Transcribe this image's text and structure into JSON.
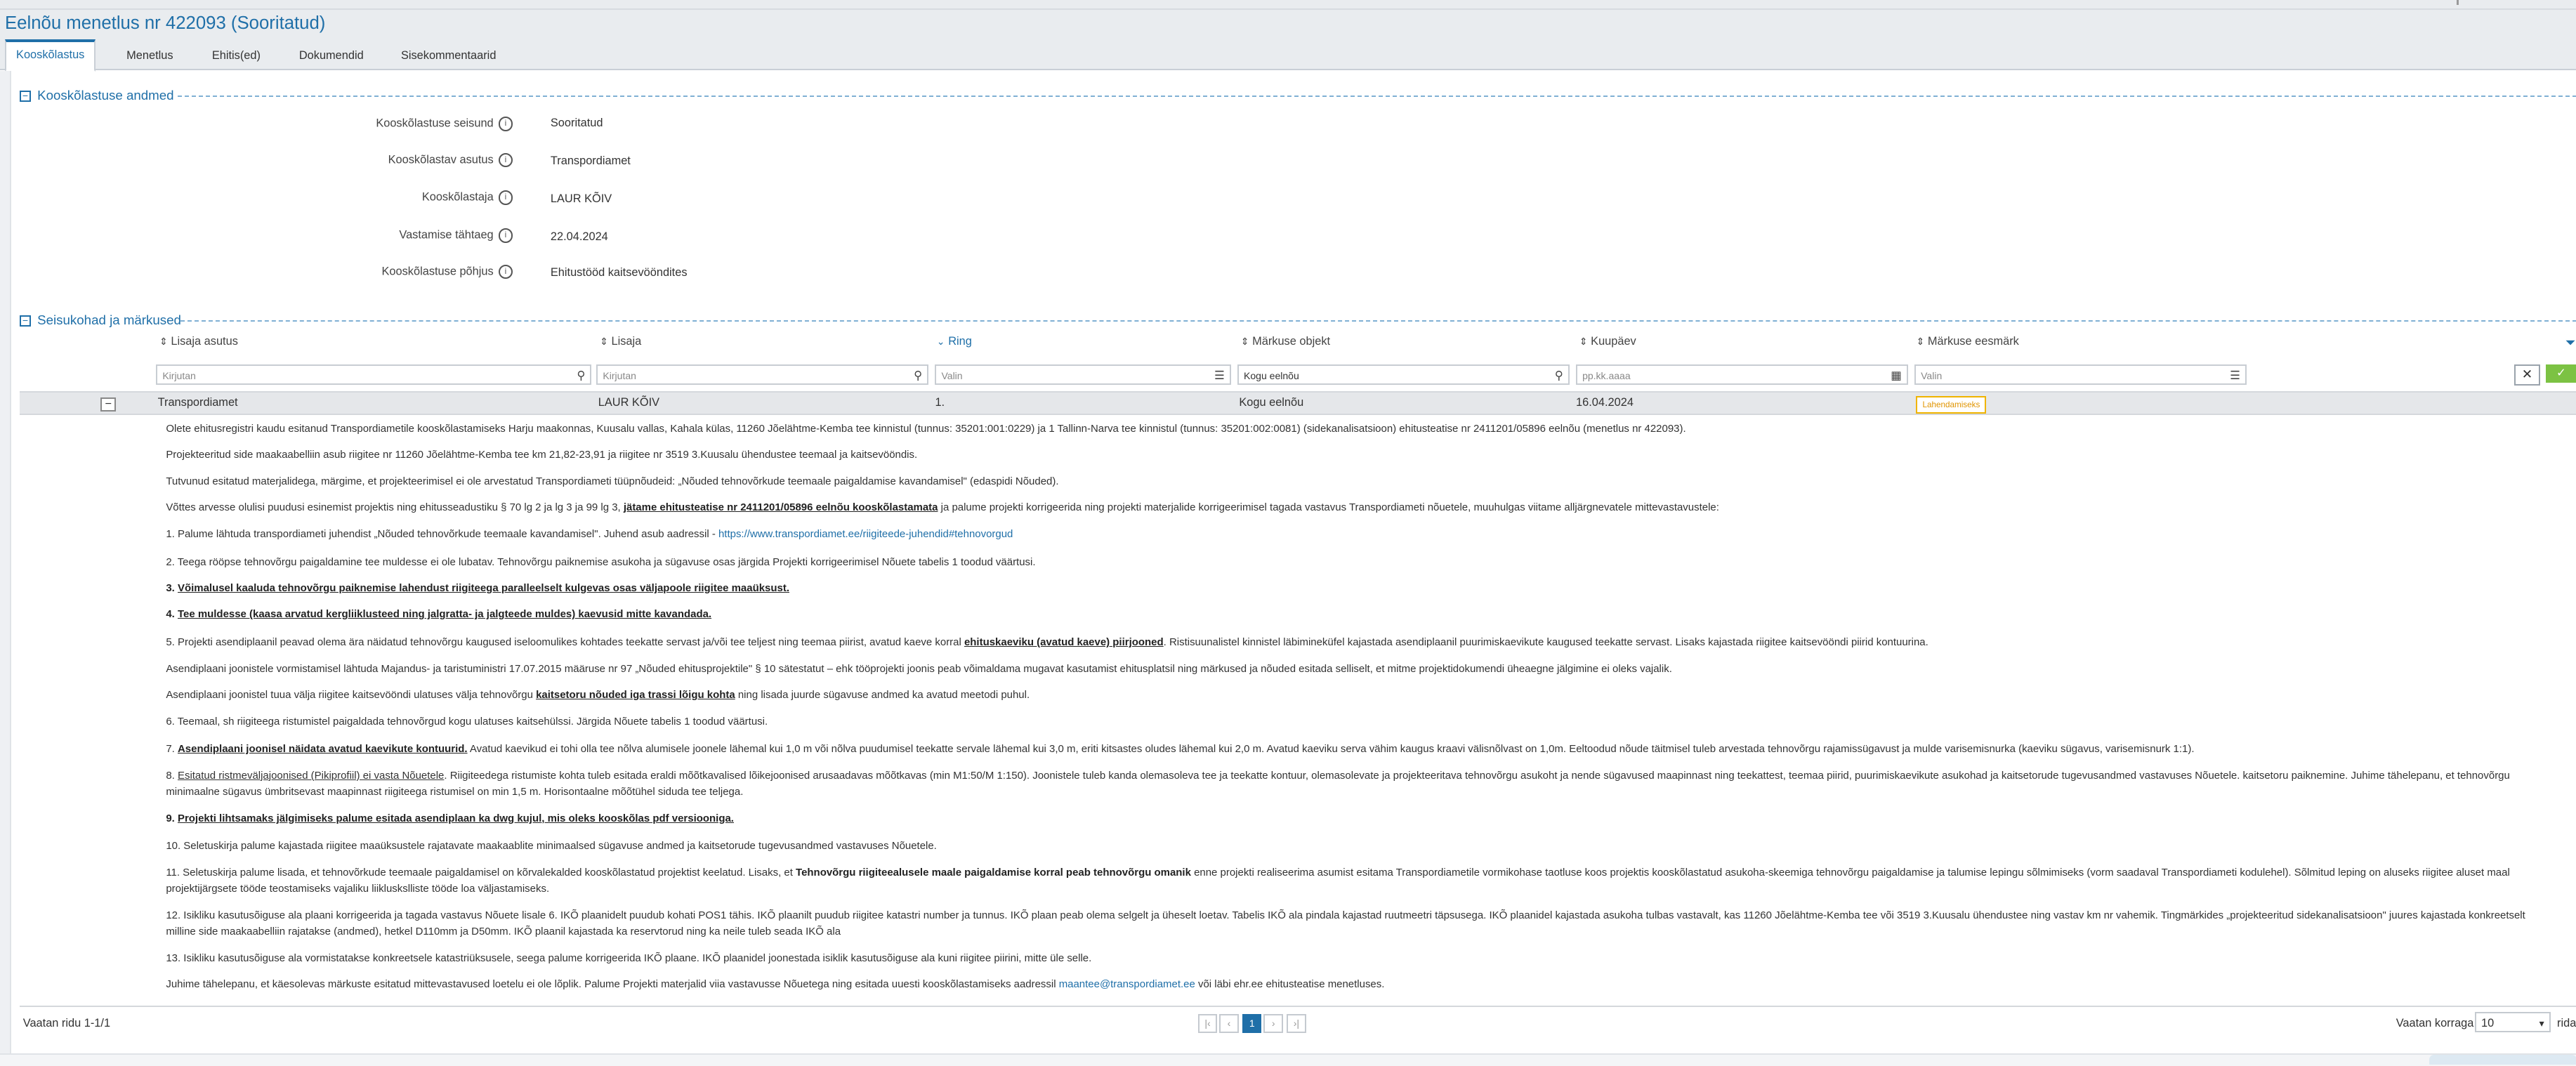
{
  "page": {
    "title": "Eelnõu menetlus nr 422093 (Sooritatud)"
  },
  "tabs": [
    {
      "label": "Kooskõlastus",
      "active": true
    },
    {
      "label": "Menetlus"
    },
    {
      "label": "Ehitis(ed)"
    },
    {
      "label": "Dokumendid"
    },
    {
      "label": "Sisekommentaarid"
    }
  ],
  "section1": {
    "title": "Kooskõlastuse andmed",
    "toggle": "−",
    "fields": [
      {
        "label": "Kooskõlastuse seisund",
        "value": "Sooritatud"
      },
      {
        "label": "Kooskõlastav asutus",
        "value": "Transpordiamet"
      },
      {
        "label": "Kooskõlastaja",
        "value": "LAUR KÕIV"
      },
      {
        "label": "Vastamise tähtaeg",
        "value": "22.04.2024"
      },
      {
        "label": "Kooskõlastuse põhjus",
        "value": "Ehitustööd kaitsevööndites"
      }
    ]
  },
  "section2": {
    "title": "Seisukohad ja märkused",
    "toggle": "−",
    "columns": [
      {
        "label": "Lisaja asutus",
        "sort": "⇕"
      },
      {
        "label": "Lisaja",
        "sort": "⇕"
      },
      {
        "label": "Ring",
        "sort": "⌄"
      },
      {
        "label": "Märkuse objekt",
        "sort": "⇕"
      },
      {
        "label": "Kuupäev",
        "sort": "⇕"
      },
      {
        "label": "Märkuse eesmärk",
        "sort": "⇕"
      }
    ],
    "filters": [
      {
        "placeholder": "Kirjutan",
        "icon": "⚲"
      },
      {
        "placeholder": "Kirjutan",
        "icon": "⚲"
      },
      {
        "placeholder": "Valin",
        "icon": "☰"
      },
      {
        "placeholder": "Kogu eelnõu",
        "icon": "⚲"
      },
      {
        "placeholder": "pp.kk.aaaa",
        "icon": "▦"
      },
      {
        "placeholder": "Valin",
        "icon": "☰"
      }
    ],
    "clear_label": "✕",
    "apply_label": "✓",
    "row": {
      "collapse": "−",
      "asutus": "Transpordiamet",
      "lisaja": "LAUR KÕIV",
      "ring": "1.",
      "objekt": "Kogu eelnõu",
      "kuupaev": "16.04.2024",
      "eesmark": "Lahendamiseks"
    },
    "detail": {
      "p1": "Olete ehitusregistri kaudu esitanud Transpordiametile kooskõlastamiseks Harju maakonnas, Kuusalu vallas, Kahala külas, 11260 Jõelähtme-Kemba tee kinnistul (tunnus: 35201:001:0229) ja 1 Tallinn-Narva tee kinnistul (tunnus: 35201:002:0081) (sidekanalisatsioon) ehitusteatise nr 2411201/05896 eelnõu (menetlus nr 422093).",
      "p2": "Projekteeritud side maakaabelliin asub riigitee nr 11260 Jõelähtme-Kemba tee km 21,82-23,91 ja riigitee nr 3519 3.Kuusalu ühendustee teemaal ja kaitsevööndis.",
      "p3": "Tutvunud esitatud materjalidega, märgime, et projekteerimisel ei ole arvestatud Transpordiameti tüüpnõudeid: „Nõuded tehnovõrkude teemaale paigaldamise kavandamisel\" (edaspidi Nõuded).",
      "p4a": "Võttes arvesse olulisi puudusi esinemist projektis ning ehitusseadustiku § 70 lg 2 ja lg 3 ja 99 lg 3, ",
      "p4b": "jätame ehitusteatise nr 2411201/05896 eelnõu kooskõlastamata",
      "p4c": " ja palume projekti korrigeerida ning projekti materjalide korrigeerimisel tagada vastavus Transpordiameti nõuetele, muuhulgas viitame alljärgnevatele mittevastavustele:",
      "p5a": "1. Palume lähtuda transpordiameti juhendist „Nõuded tehnovõrkude teemaale kavandamisel\". Juhend asub aadressil - ",
      "p5link": "https://www.transpordiamet.ee/riigiteede-juhendid#tehnovorgud",
      "p6": "2. Teega rööpse tehnovõrgu paigaldamine tee muldesse ei ole lubatav. Tehnovõrgu paiknemise asukoha ja sügavuse osas järgida Projekti korrigeerimisel Nõuete tabelis 1 toodud väärtusi.",
      "p7a": "3. ",
      "p7b": "Võimalusel kaaluda tehnovõrgu paiknemise lahendust riigiteega paralleelselt kulgevas osas väljapoole riigitee maaüksust.",
      "p8a": "4. ",
      "p8b": "Tee muldesse (kaasa arvatud kergliiklusteed ning jalgratta- ja jalgteede muldes) kaevusid mitte kavandada.",
      "p9a": "5. Projekti asendiplaanil peavad olema ära näidatud tehnovõrgu kaugused iseloomulikes kohtades teekatte servast ja/või tee teljest ning teemaa piirist, avatud kaeve korral ",
      "p9b": "ehituskaeviku (avatud kaeve) piirjooned",
      "p9c": ". Ristisuunalistel kinnistel läbimineküfel kajastada asendiplaanil puurimiskaevikute kaugused teekatte servast. Lisaks kajastada riigitee kaitsevööndi piirid kontuurina.",
      "p10": "Asendiplaani joonistele vormistamisel lähtuda Majandus- ja taristuministri 17.07.2015 määruse nr 97 „Nõuded ehitusprojektile\" § 10 sätestatut – ehk tööprojekti joonis peab võimaldama mugavat kasutamist ehitusplatsil ning märkused ja nõuded esitada selliselt, et mitme projektidokumendi üheaegne jälgimine ei oleks vajalik.",
      "p11a": "Asendiplaani joonistel tuua välja riigitee kaitsevööndi ulatuses välja tehnovõrgu ",
      "p11b": "kaitsetoru nõuded iga trassi lõigu kohta",
      "p11c": " ning lisada juurde sügavuse andmed ka avatud meetodi puhul.",
      "p12": "6. Teemaal, sh riigiteega ristumistel paigaldada tehnovõrgud kogu ulatuses kaitsehülssi. Järgida Nõuete tabelis 1 toodud väärtusi.",
      "p13a": "7. ",
      "p13b": "Asendiplaani joonisel näidata avatud kaevikute kontuurid.",
      "p13c": " Avatud kaevikud ei tohi olla tee nõlva alumisele joonele lähemal kui 1,0 m või nõlva puudumisel teekatte servale lähemal kui 3,0 m, eriti kitsastes oludes lähemal kui 2,0 m. Avatud kaeviku serva vähim kaugus kraavi välisnõlvast on 1,0m. Eeltoodud nõude täitmisel tuleb arvestada tehnovõrgu rajamissügavust ja mulde varisemisnurka (kaeviku sügavus, varisemisnurk 1:1).",
      "p14a": "8. ",
      "p14b": "Esitatud ristmeväljajoonised (Pikiprofiil) ei vasta Nõuetele",
      "p14c": ". Riigiteedega ristumiste kohta tuleb esitada eraldi mõõtkavalised lõikejoonised arusaadavas mõõtkavas (min M1:50/M 1:150). Joonistele tuleb kanda olemasoleva tee ja teekatte kontuur, olemasolevate ja projekteeritava tehnovõrgu asukoht ja nende sügavused maapinnast ning teekattest, teemaa piirid, puurimiskaevikute asukohad ja kaitsetorude tugevusandmed vastavuses Nõuetele. kaitsetoru paiknemine. Juhime tähelepanu, et tehnovõrgu minimaalne sügavus ümbritsevast maapinnast riigiteega ristumisel on min 1,5 m. Horisontaalne mõõtühel siduda tee teljega.",
      "p15a": "9. ",
      "p15b": "Projekti lihtsamaks jälgimiseks palume esitada asendiplaan ka dwg kujul, mis oleks kooskõlas pdf versiooniga.",
      "p16": "10. Seletuskirja palume kajastada riigitee maaüksustele rajatavate maakaablite minimaalsed sügavuse andmed ja kaitsetorude tugevusandmed vastavuses Nõuetele.",
      "p17a": "11. Seletuskirja palume lisada, et tehnovõrkude teemaale paigaldamisel on kõrvalekalded kooskõlastatud projektist keelatud.  Lisaks, et ",
      "p17b": "Tehnovõrgu riigiteealusele maale paigaldamise korral peab tehnovõrgu omanik",
      "p17c": " enne projekti realiseerima asumist esitama Transpordiametile vormikohase taotluse koos projektis kooskõlastatud asukoha-skeemiga tehnovõrgu paigaldamise ja talumise lepingu sõlmimiseks (vorm saadaval Transpordiameti kodulehel). Sõlmitud leping on aluseks riigitee aluset maal projektijärgsete tööde teostamiseks vajaliku liikluskslliste tööde loa väljastamiseks.",
      "p18": "12. Isikliku kasutusõiguse ala plaani korrigeerida ja tagada vastavus Nõuete lisale 6. IKÕ plaanidelt puudub kohati POS1 tähis. IKÕ plaanilt puudub riigitee katastri number ja tunnus. IKÕ plaan peab olema selgelt ja üheselt loetav. Tabelis IKÕ ala pindala kajastad ruutmeetri täpsusega. IKÕ plaanidel kajastada asukoha tulbas vastavalt, kas 11260 Jõelähtme-Kemba tee või 3519 3.Kuusalu ühendustee ning vastav km nr vahemik. Tingmärkides „projekteeritud sidekanalisatsioon\" juures kajastada konkreetselt milline side maakaabelliin rajatakse (andmed), hetkel D110mm ja D50mm. IKÕ plaanil kajastada ka reservtorud ning ka neile tuleb seada IKÕ ala",
      "p19": "13. Isikliku kasutusõiguse ala vormistatakse konkreetsele katastriüksusele, seega palume korrigeerida IKÕ plaane. IKÕ plaanidel joonestada isiklik kasutusõiguse ala kuni riigitee piirini, mitte üle selle.",
      "p20a": "Juhime tähelepanu, et käesolevas märkuste esitatud mittevastavused loetelu ei ole lõplik. Palume Projekti materjalid viia vastavusse Nõuetega ning esitada uuesti kooskõlastamiseks aadressil ",
      "p20link": "maantee@transpordiamet.ee",
      "p20c": " või läbi ehr.ee ehitusteatise menetluses."
    }
  },
  "footer": {
    "rows_text": "Vaatan ridu 1-1/1",
    "pager": {
      "first": "|‹",
      "prev": "‹",
      "current": "1",
      "next": "›",
      "last": "›|"
    },
    "per_page_label": "Vaatan korraga",
    "per_page_value": "10",
    "per_page_suffix": "rida"
  },
  "colors": {
    "accent": "#1f6fa8",
    "badge": "#f0b400",
    "ok": "#7cc243"
  }
}
